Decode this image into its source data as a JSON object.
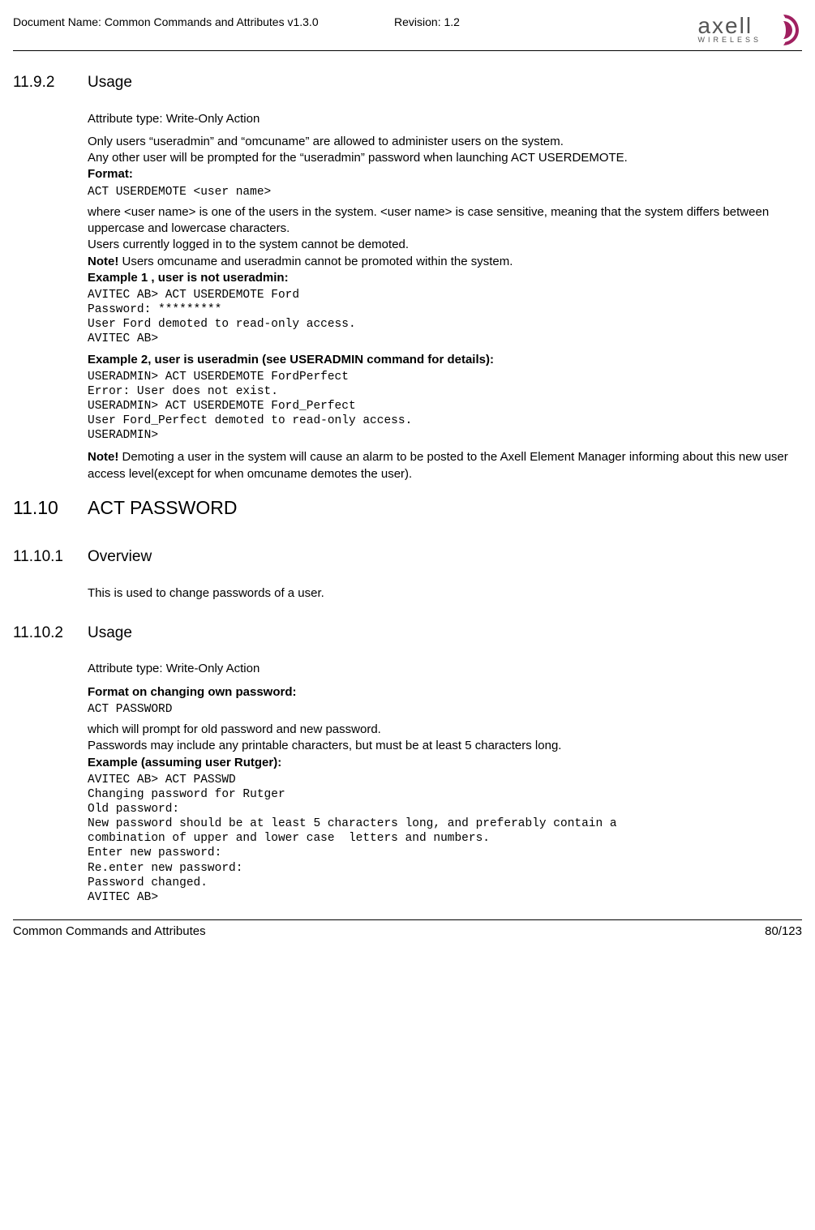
{
  "header": {
    "doc_name": "Document Name: Common Commands and Attributes v1.3.0",
    "revision": "Revision: 1.2",
    "logo_main": "axell",
    "logo_sub": "WIRELESS"
  },
  "s1": {
    "num": "11.9.2",
    "title": "Usage",
    "attr_type": "Attribute type: Write-Only Action",
    "p1": "Only users “useradmin” and “omcuname” are allowed to administer users on the system.",
    "p2": "Any other user will be prompted for the “useradmin” password when launching ACT USERDEMOTE.",
    "format_label": "Format:",
    "code1": "ACT USERDEMOTE <user name>",
    "p3": "where <user name> is one of the users in the system. <user name> is case sensitive, meaning that the system differs between uppercase and lowercase characters.",
    "p4": "Users currently logged in to the system cannot be demoted.",
    "note1_b": "Note!",
    "note1_t": " Users omcuname and useradmin cannot be promoted within the system.",
    "ex1_label": "Example 1 , user is not useradmin:",
    "code2": "AVITEC AB> ACT USERDEMOTE Ford\nPassword: *********\nUser Ford demoted to read-only access.\nAVITEC AB>",
    "ex2_label": "Example 2, user is useradmin (see USERADMIN command for details):",
    "code3": "USERADMIN> ACT USERDEMOTE FordPerfect\nError: User does not exist.\nUSERADMIN> ACT USERDEMOTE Ford_Perfect\nUser Ford_Perfect demoted to read-only access.\nUSERADMIN>",
    "note2_b": "Note!",
    "note2_t": " Demoting a user in the system will cause an alarm to be posted to the Axell Element Manager informing about this new user access level(except for when omcuname demotes the user)."
  },
  "s2": {
    "num": "11.10",
    "title": "ACT PASSWORD"
  },
  "s3": {
    "num": "11.10.1",
    "title": "Overview",
    "p1": "This is used to change passwords of a user."
  },
  "s4": {
    "num": "11.10.2",
    "title": "Usage",
    "attr_type": "Attribute type: Write-Only Action",
    "fmt_label": "Format on changing own password:",
    "code1": "ACT PASSWORD",
    "p1": "which will prompt for old password and new password.",
    "p2": "Passwords may include any printable characters, but must be at least 5 characters long.",
    "ex_label": "Example (assuming user Rutger):",
    "code2": "AVITEC AB> ACT PASSWD\nChanging password for Rutger\nOld password:\nNew password should be at least 5 characters long, and preferably contain a\ncombination of upper and lower case  letters and numbers.\nEnter new password:\nRe.enter new password:\nPassword changed.\nAVITEC AB>"
  },
  "footer": {
    "left": "Common Commands and Attributes",
    "right": "80/123"
  }
}
